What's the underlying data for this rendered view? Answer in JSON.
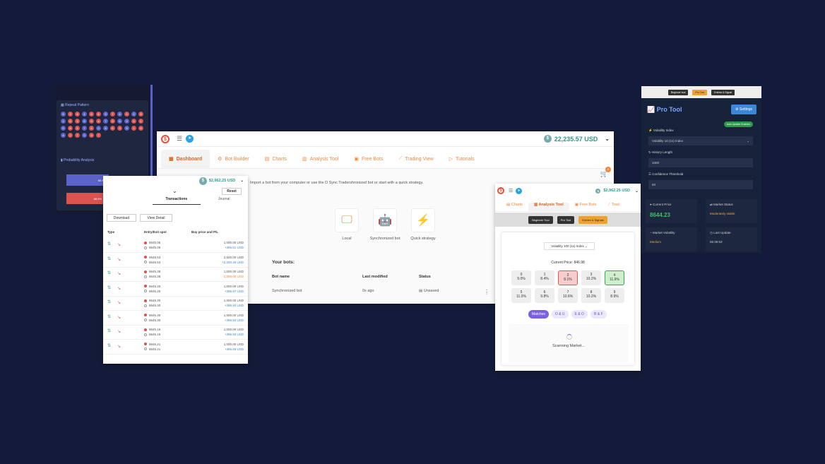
{
  "left_panel": {
    "repeat_title": "Repeat Pattern",
    "balls": [
      {
        "n": "5",
        "c": "b"
      },
      {
        "n": "2",
        "c": "r"
      },
      {
        "n": "8",
        "c": "r"
      },
      {
        "n": "1",
        "c": "b"
      },
      {
        "n": "9",
        "c": "r"
      },
      {
        "n": "6",
        "c": "r"
      },
      {
        "n": "3",
        "c": "b"
      },
      {
        "n": "7",
        "c": "r"
      },
      {
        "n": "4",
        "c": "b"
      },
      {
        "n": "0",
        "c": "r"
      },
      {
        "n": "2",
        "c": "b"
      },
      {
        "n": "5",
        "c": "r"
      },
      {
        "n": "1",
        "c": "b"
      },
      {
        "n": "8",
        "c": "r"
      },
      {
        "n": "3",
        "c": "r"
      },
      {
        "n": "6",
        "c": "b"
      },
      {
        "n": "9",
        "c": "r"
      },
      {
        "n": "4",
        "c": "r"
      },
      {
        "n": "7",
        "c": "b"
      },
      {
        "n": "0",
        "c": "r"
      },
      {
        "n": "6",
        "c": "b"
      },
      {
        "n": "3",
        "c": "b"
      },
      {
        "n": "9",
        "c": "r"
      },
      {
        "n": "1",
        "c": "r"
      },
      {
        "n": "5",
        "c": "b"
      },
      {
        "n": "8",
        "c": "r"
      },
      {
        "n": "2",
        "c": "r"
      },
      {
        "n": "7",
        "c": "b"
      },
      {
        "n": "4",
        "c": "r"
      },
      {
        "n": "0",
        "c": "b"
      },
      {
        "n": "8",
        "c": "b"
      },
      {
        "n": "6",
        "c": "r"
      },
      {
        "n": "3",
        "c": "r"
      },
      {
        "n": "5",
        "c": "b"
      },
      {
        "n": "1",
        "c": "r"
      },
      {
        "n": "9",
        "c": "r"
      },
      {
        "n": "4",
        "c": "b"
      },
      {
        "n": "2",
        "c": "r"
      },
      {
        "n": "7",
        "c": "r"
      },
      {
        "n": "0",
        "c": "b"
      },
      {
        "n": "3",
        "c": "r"
      },
      {
        "n": "7",
        "c": "r"
      }
    ],
    "prob_title": "Probability Analysis",
    "prob_bars": [
      {
        "label": "88.9%",
        "color": "#5b63c9"
      },
      {
        "label": "88.9%",
        "color": "#d9534f"
      }
    ]
  },
  "dashboard": {
    "balance": "22,235.57 USD",
    "tabs": [
      "Dashboard",
      "Bot Builder",
      "Charts",
      "Analysis Tool",
      "Free Bots",
      "Trading View",
      "Tutorials"
    ],
    "import_text": "Import a bot from your computer or use the D Sync Tradershronized bot or start with a quick strategy.",
    "options": [
      "Local",
      "Synchronized bot",
      "Quick strategy"
    ],
    "your_bots": "Your bots:",
    "columns": [
      "Bot name",
      "Last modified",
      "Status"
    ],
    "row": {
      "name": "Synchronized bot",
      "modified": "0s ago",
      "status": "Unsaved"
    },
    "cart_count": "0"
  },
  "transactions": {
    "balance": "$2,962.25 USD",
    "reset": "Reset",
    "tabs": [
      "Transactions",
      "Journal"
    ],
    "download": "Download",
    "view_detail": "View Detail",
    "columns": [
      "Type",
      "Entry/Exit spot",
      "Buy price and P/L"
    ],
    "rows": [
      {
        "entry": "8645.05",
        "exit": "8645.05",
        "buy": "1,000.00 USD",
        "pl": "+395.51 USD",
        "pl_color": "#3b86d6"
      },
      {
        "entry": "8645.53",
        "exit": "8645.53",
        "buy": "2,500.00 USD",
        "pl": "+2,293.29 USD",
        "pl_color": "#3b86d6"
      },
      {
        "entry": "8645.38",
        "exit": "8645.38",
        "buy": "1,000.00 USD",
        "pl": "-1,000.00 USD",
        "pl_color": "#f0883e"
      },
      {
        "entry": "8645.25",
        "exit": "8645.25",
        "buy": "1,000.00 USD",
        "pl": "+395.97 USD",
        "pl_color": "#3b86d6"
      },
      {
        "entry": "8645.30",
        "exit": "8645.30",
        "buy": "1,000.00 USD",
        "pl": "+395.93 USD",
        "pl_color": "#3b86d6"
      },
      {
        "entry": "8645.30",
        "exit": "8645.30",
        "buy": "1,000.00 USD",
        "pl": "+395.93 USD",
        "pl_color": "#3b86d6"
      },
      {
        "entry": "8645.16",
        "exit": "8645.16",
        "buy": "1,000.00 USD",
        "pl": "+395.93 USD",
        "pl_color": "#3b86d6"
      },
      {
        "entry": "8645.21",
        "exit": "8645.21",
        "buy": "1,000.00 USD",
        "pl": "+395.93 USD",
        "pl_color": "#3b86d6"
      }
    ]
  },
  "analysis": {
    "balance": "$2,962.25 USD",
    "tabs": [
      "Charts",
      "Analysis Tool",
      "Free Bots",
      "Trad"
    ],
    "buttons": [
      "Beginner Tool",
      "Pro Tool",
      "Entries & Signals"
    ],
    "select": "Volatility 100 (1s) Index",
    "current_price": "Current Price: 846.98",
    "digits": [
      {
        "d": "0",
        "p": "9.0%",
        "s": ""
      },
      {
        "d": "1",
        "p": "8.4%",
        "s": ""
      },
      {
        "d": "2",
        "p": "8.1%",
        "s": "red"
      },
      {
        "d": "3",
        "p": "10.2%",
        "s": ""
      },
      {
        "d": "4",
        "p": "11.9%",
        "s": "green"
      },
      {
        "d": "5",
        "p": "11.0%",
        "s": ""
      },
      {
        "d": "6",
        "p": "9.8%",
        "s": ""
      },
      {
        "d": "7",
        "p": "10.6%",
        "s": ""
      },
      {
        "d": "8",
        "p": "10.2%",
        "s": ""
      },
      {
        "d": "9",
        "p": "8.9%",
        "s": ""
      }
    ],
    "pills": [
      "Matches",
      "O & U",
      "E & O",
      "R & F"
    ],
    "scanning": "Scanning Market..."
  },
  "pro": {
    "bar_buttons": [
      "Beginner tool",
      "Pro Tool",
      "Entries & Signal"
    ],
    "title": "Pro Tool",
    "settings": "Settings",
    "auto": "Auto Update Enabled",
    "vol_label": "Volatility Index",
    "vol_value": "Volatility 10 (1s) Index",
    "hist_label": "History Length",
    "hist_value": "1000",
    "conf_label": "Confidence Threshold",
    "conf_value": "50",
    "current_price_label": "Current Price",
    "current_price": "8644.23",
    "market_status_label": "Market Status",
    "market_status": "Moderately stable",
    "market_vol_label": "Market Volatility",
    "market_vol": "Medium",
    "last_update_label": "Last Update",
    "last_update": "06:39:53"
  }
}
